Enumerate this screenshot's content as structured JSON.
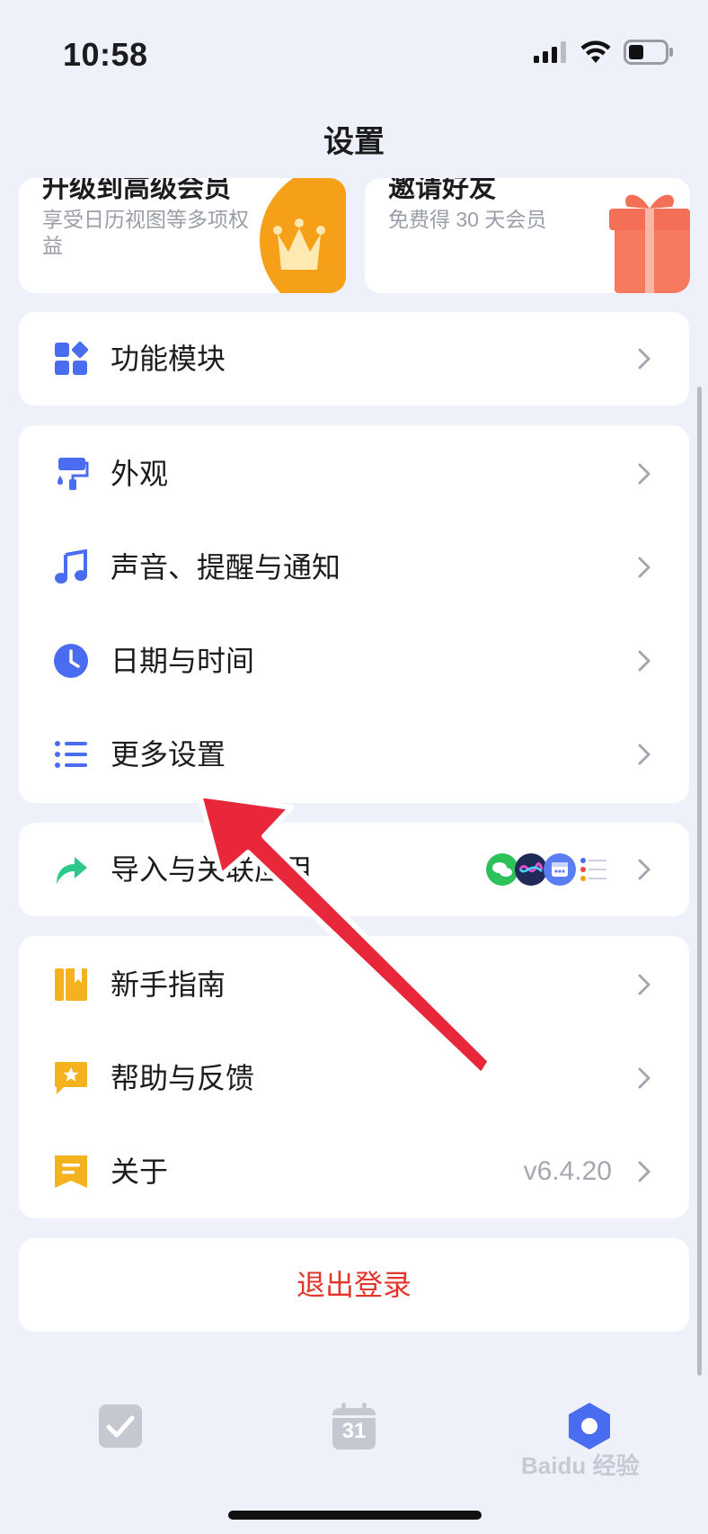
{
  "status_bar": {
    "time": "10:58"
  },
  "nav": {
    "title": "设置"
  },
  "promo": {
    "upgrade": {
      "title": "升级到高级会员",
      "subtitle": "享受日历视图等多项权益"
    },
    "invite": {
      "title": "邀请好友",
      "subtitle": "免费得 30 天会员"
    }
  },
  "menu": {
    "modules": {
      "label": "功能模块"
    },
    "appearance": {
      "label": "外观"
    },
    "sound": {
      "label": "声音、提醒与通知"
    },
    "datetime": {
      "label": "日期与时间"
    },
    "more": {
      "label": "更多设置"
    },
    "import": {
      "label": "导入与关联应用"
    },
    "guide": {
      "label": "新手指南"
    },
    "help": {
      "label": "帮助与反馈"
    },
    "about": {
      "label": "关于",
      "value": "v6.4.20"
    }
  },
  "logout": {
    "label": "退出登录"
  },
  "tabs": {
    "calendar_day": "31"
  },
  "watermark": {
    "text": "Baidu 经验"
  },
  "colors": {
    "accent_blue": "#4a6cf0",
    "logout_red": "#e4352d",
    "gold": "#f5b21f",
    "orange": "#f6a01a",
    "gift": "#f36f56",
    "green_arrow": "#2ec98a",
    "annotation_red": "#e8283a"
  }
}
